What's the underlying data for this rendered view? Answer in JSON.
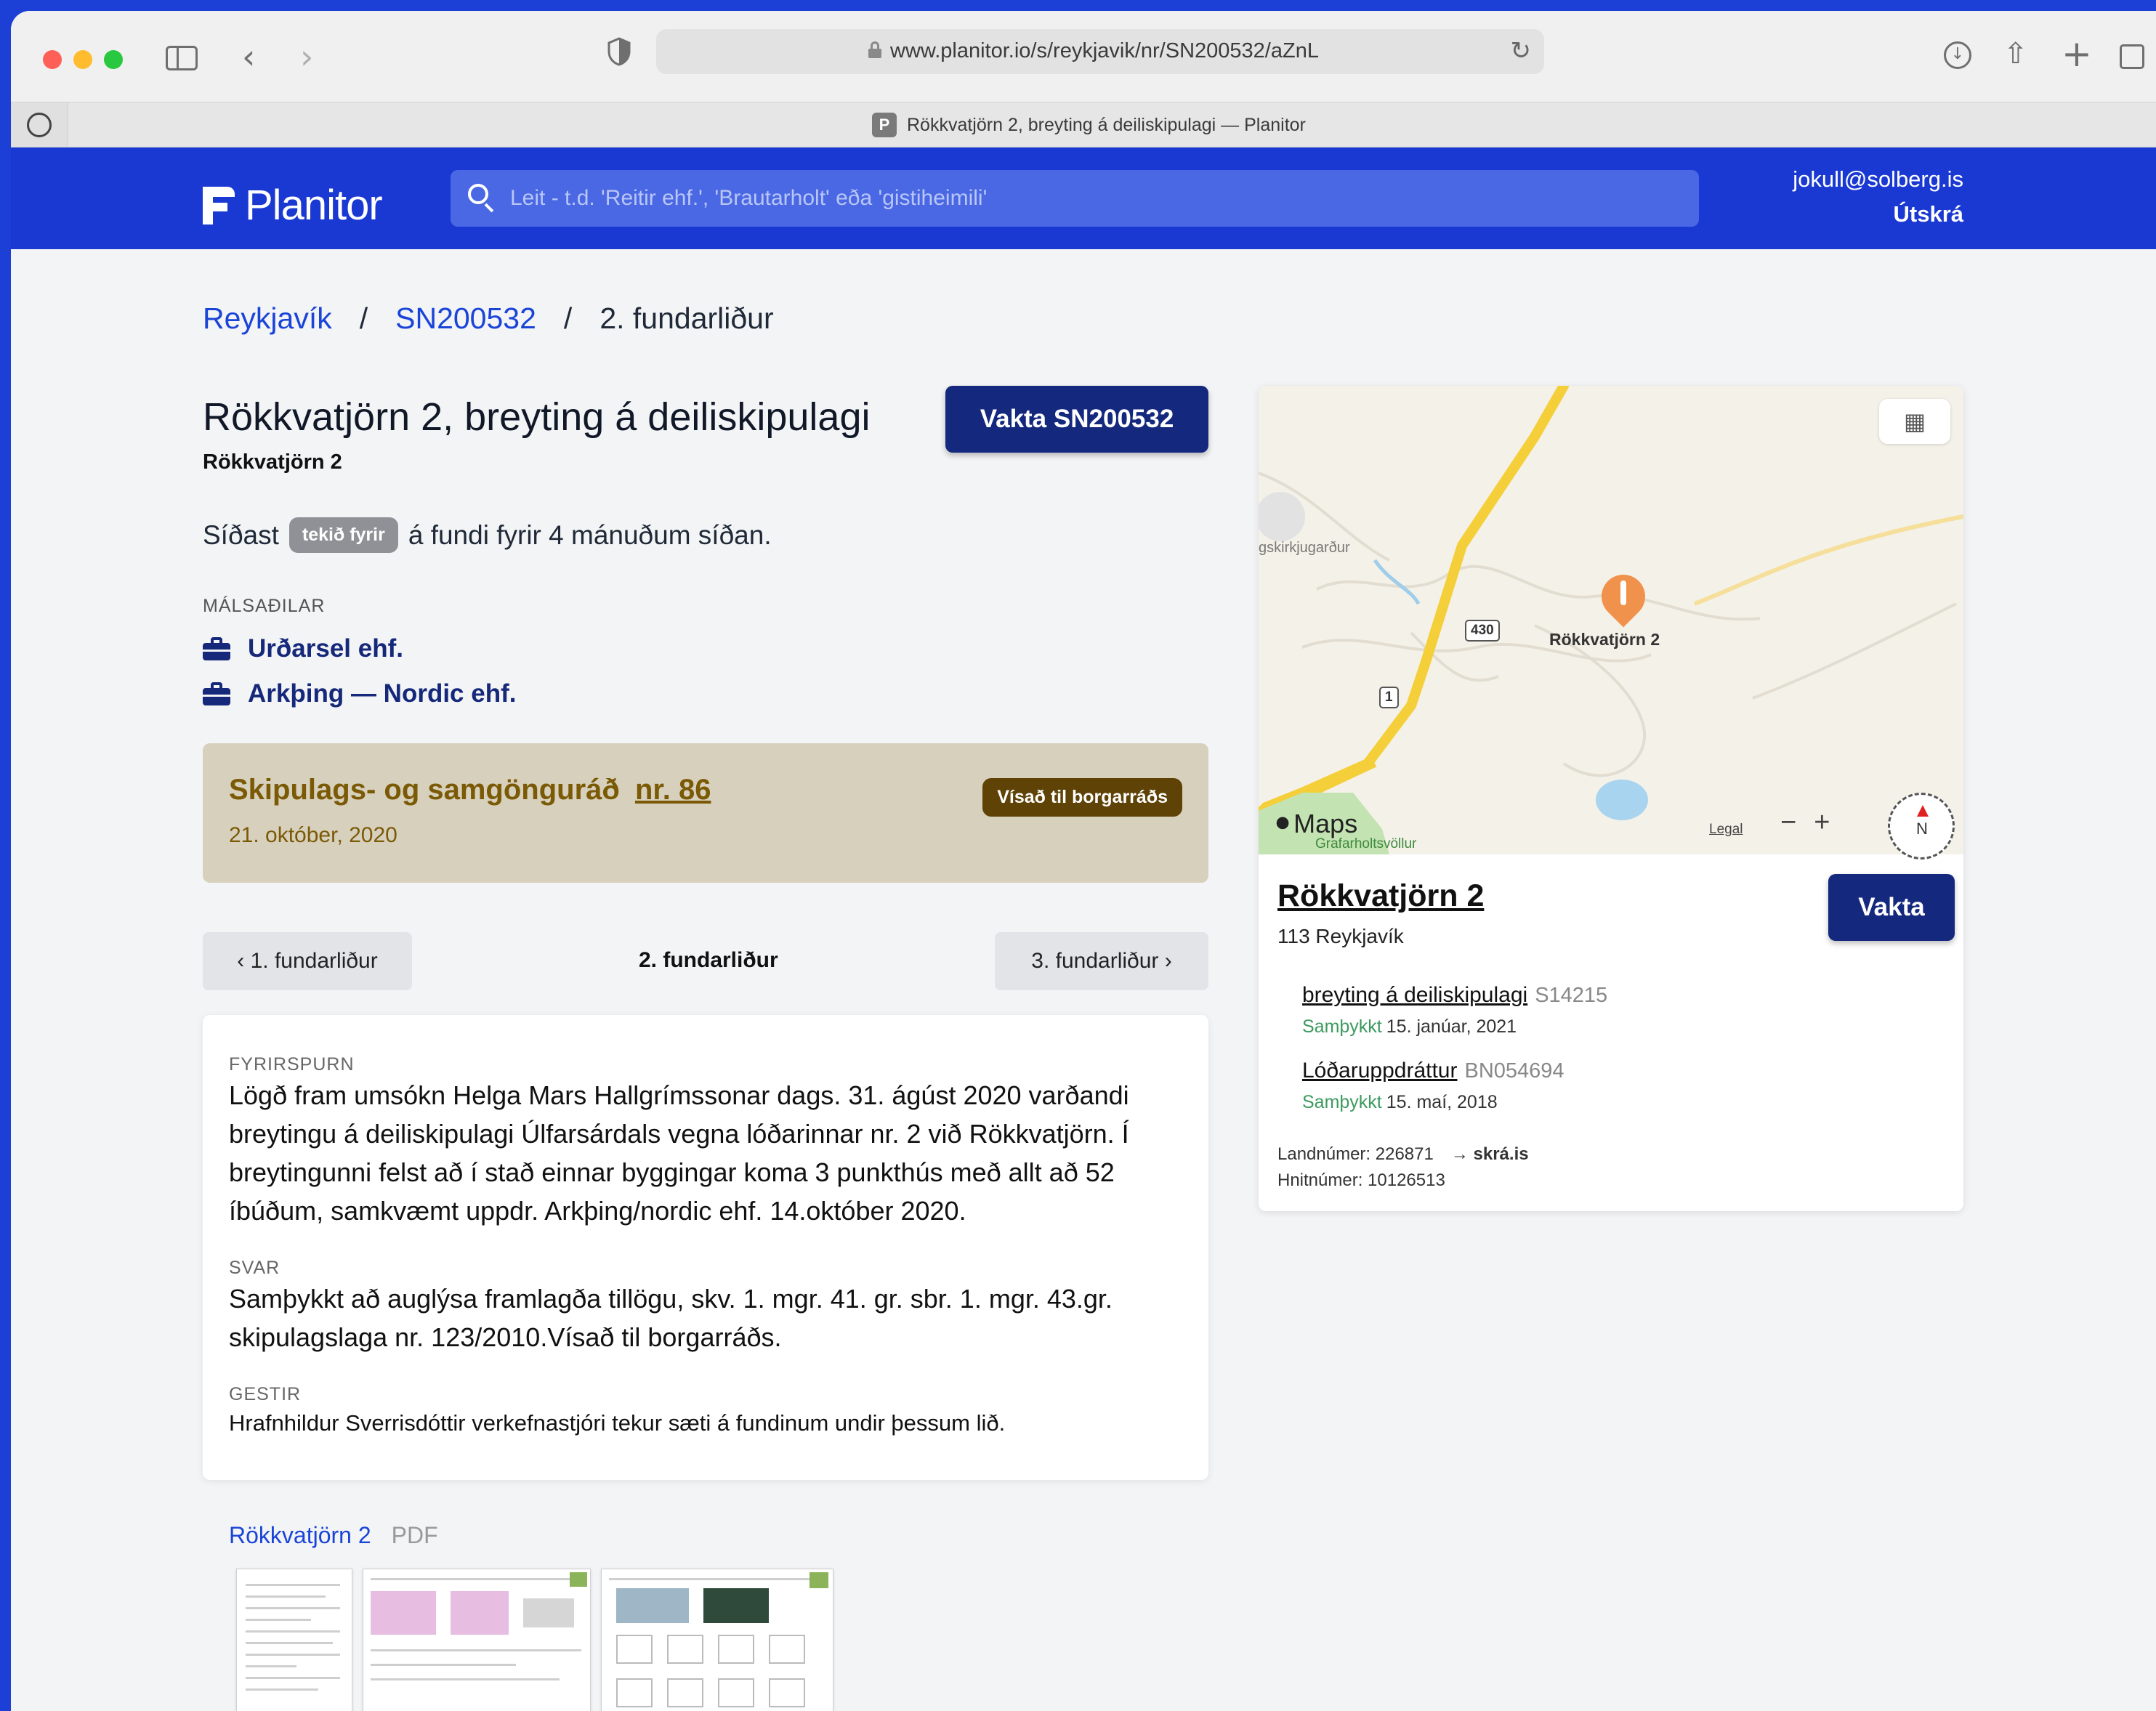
{
  "browser": {
    "url": "www.planitor.io/s/reykjavik/nr/SN200532/aZnL",
    "tab_title": "Rökkvatjörn 2, breyting á deiliskipulagi — Planitor",
    "tab_favicon_letter": "P",
    "icons": [
      "sidebar-icon",
      "back-icon",
      "forward-icon",
      "shield-icon",
      "lock-icon",
      "reload-icon",
      "download-icon",
      "share-icon",
      "new-tab-icon",
      "tabs-overview-icon"
    ]
  },
  "header": {
    "logo_text": "Planitor",
    "search_placeholder": "Leit - t.d. 'Reitir ehf.', 'Brautarholt' eða 'gistiheimili'",
    "user_email": "jokull@solberg.is",
    "logout_label": "Útskrá"
  },
  "breadcrumb": {
    "items": [
      "Reykjavík",
      "SN200532",
      "2. fundarliður"
    ],
    "separator": "/"
  },
  "case": {
    "title": "Rökkvatjörn 2, breyting á deiliskipulagi",
    "subtitle": "Rökkvatjörn 2",
    "watch_button": "Vakta SN200532",
    "last_seen_prefix": "Síðast",
    "last_seen_pill": "tekið fyrir",
    "last_seen_suffix": "á fundi fyrir 4 mánuðum síðan.",
    "parties_label": "MÁLSAÐILAR",
    "parties": [
      "Urðarsel ehf.",
      "Arkþing — Nordic ehf."
    ]
  },
  "meeting": {
    "title": "Skipulags- og samgönguráð",
    "number": "nr. 86",
    "date": "21. október, 2020",
    "status": "Vísað til borgarráðs"
  },
  "pager": {
    "prev": "‹ 1. fundarliður",
    "current": "2. fundarliður",
    "next": "3. fundarliður ›"
  },
  "minutes": {
    "inquiry_label": "FYRIRSPURN",
    "inquiry_text": "Lögð fram umsókn Helga Mars Hallgrímssonar dags. 31. ágúst 2020 varðandi breytingu á deiliskipulagi Úlfarsárdals vegna lóðarinnar nr. 2 við Rökkvatjörn. Í breytingunni felst að í stað einnar byggingar koma 3 punkthús með allt að 52 íbúðum, samkvæmt uppdr. Arkþing/nordic ehf. 14.október 2020.",
    "answer_label": "SVAR",
    "answer_text": "Samþykkt að auglýsa framlagða tillögu, skv. 1. mgr. 41. gr. sbr. 1. mgr. 43.gr. skipulagslaga nr. 123/2010.Vísað til borgarráðs.",
    "guests_label": "GESTIR",
    "guests_text": "Hrafnhildur Sverrisdóttir verkefnastjóri tekur sæti á fundinum undir þessum lið."
  },
  "attachment": {
    "name": "Rökkvatjörn 2",
    "type": "PDF"
  },
  "map": {
    "pin_label": "Rökkvatjörn 2",
    "poi_label": "gskirkjugarður",
    "green_label": "Grafarholtsvöllur",
    "road_430": "430",
    "road_1": "1",
    "maps_brand": "Maps",
    "legal": "Legal",
    "zoom_out": "−",
    "zoom_in": "+",
    "compass_n": "N"
  },
  "place": {
    "title": "Rökkvatjörn 2",
    "postal": "113 Reykjavík",
    "watch_button": "Vakta",
    "cases": [
      {
        "name": "breyting á deiliskipulagi",
        "id": "S14215",
        "status": "Samþykkt",
        "date": "15. janúar, 2021"
      },
      {
        "name": "Lóðaruppdráttur",
        "id": "BN054694",
        "status": "Samþykkt",
        "date": "15. maí, 2018"
      }
    ],
    "land_number": "Landnúmer: 226871",
    "skra_link": "→ skrá.is",
    "hnit_number": "Hnitnúmer: 10126513"
  },
  "colors": {
    "brand_blue": "#1a39d3",
    "navy_button": "#14287e",
    "meeting_bg": "#d7d0bd",
    "meeting_text": "#7b5a06",
    "approved_green": "#3d9a5f"
  }
}
